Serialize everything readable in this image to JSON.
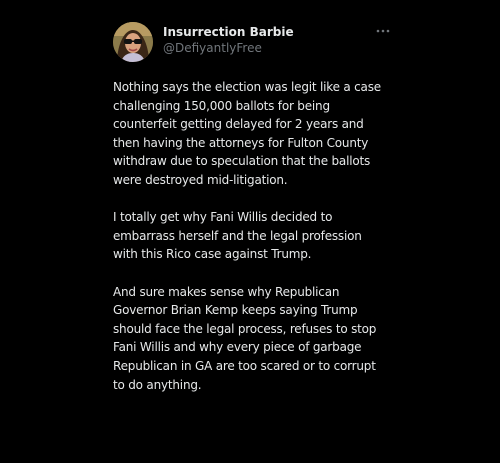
{
  "tweet": {
    "display_name": "Insurrection Barbie",
    "handle": "@DefiyantlyFree",
    "more_icon": "more-horizontal-icon",
    "paragraphs": [
      [
        "Nothing says the election was legit like a case",
        "challenging 150,000 ballots for being",
        "counterfeit getting delayed for 2 years and",
        "then having the attorneys for Fulton County",
        "withdraw due to speculation that the ballots",
        "were destroyed mid-litigation."
      ],
      [
        "I totally get why Fani Willis decided to",
        "embarrass herself and the legal profession",
        "with this Rico case against Trump."
      ],
      [
        "And sure makes sense why Republican",
        "Governor Brian Kemp keeps saying Trump",
        "should face the legal process, refuses to stop",
        "Fani Willis and why every piece of garbage",
        "Republican in GA are too scared or to corrupt",
        "to do anything."
      ]
    ]
  }
}
